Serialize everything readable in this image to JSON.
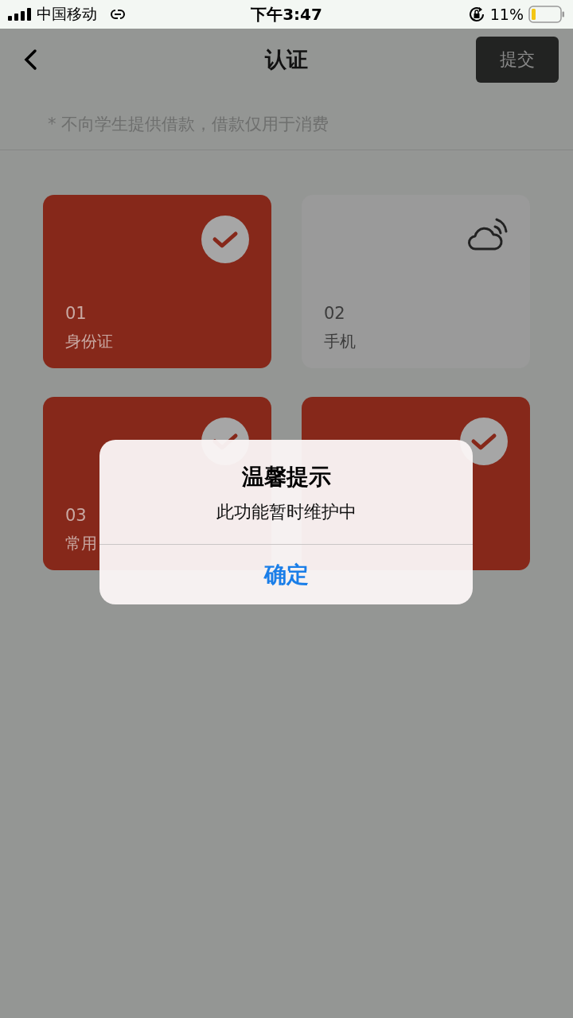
{
  "status_bar": {
    "carrier": "中国移动",
    "time": "下午3:47",
    "battery": "11%"
  },
  "header": {
    "title": "认证",
    "submit": "提交"
  },
  "notice": "* 不向学生提供借款，借款仅用于消费",
  "cards": [
    {
      "number": "01",
      "label": "身份证",
      "completed": true
    },
    {
      "number": "02",
      "label": "手机",
      "completed": false
    },
    {
      "number": "03",
      "label": "常用",
      "completed": true
    },
    {
      "completed": true
    }
  ],
  "dialog": {
    "title": "温馨提示",
    "message": "此功能暂时维护中",
    "button": "确定"
  }
}
